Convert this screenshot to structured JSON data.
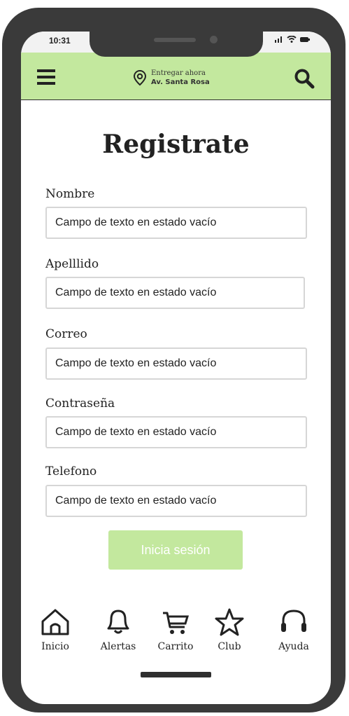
{
  "status": {
    "time": "10:31"
  },
  "header": {
    "deliver_label": "Entregar ahora",
    "address": "Av. Santa Rosa",
    "menu_icon": "hamburger-menu-icon",
    "search_icon": "search-icon",
    "location_icon": "location-pin-icon"
  },
  "form": {
    "title": "Registrate",
    "fields": [
      {
        "label": "Nombre",
        "placeholder": "Campo de texto en estado vacío",
        "value": ""
      },
      {
        "label": "Apelllido",
        "placeholder": "Campo de texto en estado vacío",
        "value": ""
      },
      {
        "label": "Correo",
        "placeholder": "Campo de texto en estado vacío",
        "value": ""
      },
      {
        "label": "Contraseña",
        "placeholder": "Campo de texto en estado vacío",
        "value": ""
      },
      {
        "label": "Telefono",
        "placeholder": "Campo de texto en estado vacío",
        "value": ""
      }
    ],
    "submit_label": "Inicia sesión"
  },
  "bottom_nav": {
    "items": [
      {
        "label": "Inicio",
        "icon": "home-icon"
      },
      {
        "label": "Alertas",
        "icon": "bell-icon"
      },
      {
        "label": "Carrito",
        "icon": "cart-icon"
      },
      {
        "label": "Club",
        "icon": "star-icon"
      },
      {
        "label": "Ayuda",
        "icon": "headset-icon"
      }
    ]
  },
  "colors": {
    "accent": "#c3e89e",
    "frame": "#3a3a3a",
    "text": "#222222"
  }
}
